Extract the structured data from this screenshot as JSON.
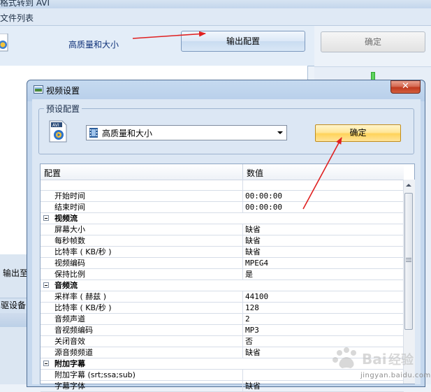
{
  "background_window": {
    "title_fragment": "格式转到 AVI",
    "file_list_label": "文件列表",
    "quality_text": "高质量和大小",
    "output_config_button": "输出配置",
    "confirm_button": "确定",
    "output_label": "输出至",
    "device_label": "驱设备"
  },
  "dialog": {
    "title": "视频设置",
    "close_glyph": "✕",
    "preset_group_label": "预设配置",
    "preset_selected": "高质量和大小",
    "confirm_button": "确定",
    "grid": {
      "header_config": "配置",
      "header_value": "数值",
      "rows": [
        {
          "key": "",
          "value": ""
        },
        {
          "key": "开始时间",
          "value": "00:00:00"
        },
        {
          "key": "结束时间",
          "value": "00:00:00"
        },
        {
          "section": "视频流"
        },
        {
          "key": "屏幕大小",
          "value": "缺省"
        },
        {
          "key": "每秒帧数",
          "value": "缺省"
        },
        {
          "key": "比特率 ( KB/秒 )",
          "value": "缺省"
        },
        {
          "key": "视频编码",
          "value": "MPEG4"
        },
        {
          "key": "保持比例",
          "value": "是"
        },
        {
          "section": "音频流"
        },
        {
          "key": "采样率 ( 赫兹 )",
          "value": "44100"
        },
        {
          "key": "比特率 ( KB/秒 )",
          "value": "128"
        },
        {
          "key": "音频声道",
          "value": "2"
        },
        {
          "key": "音视频编码",
          "value": "MP3"
        },
        {
          "key": "关闭音效",
          "value": "否"
        },
        {
          "key": "源音频频道",
          "value": "缺省"
        },
        {
          "section": "附加字幕"
        },
        {
          "key": "附加字幕 (srt;ssa;sub)",
          "value": ""
        },
        {
          "key": "字幕字体",
          "value": "缺省"
        }
      ]
    }
  },
  "watermark": {
    "text": "jingyan.baidu.com"
  },
  "colors": {
    "arrow": "#e02020",
    "confirm_highlight": "#ffd35a",
    "dialog_frame": "#4f6e95"
  }
}
